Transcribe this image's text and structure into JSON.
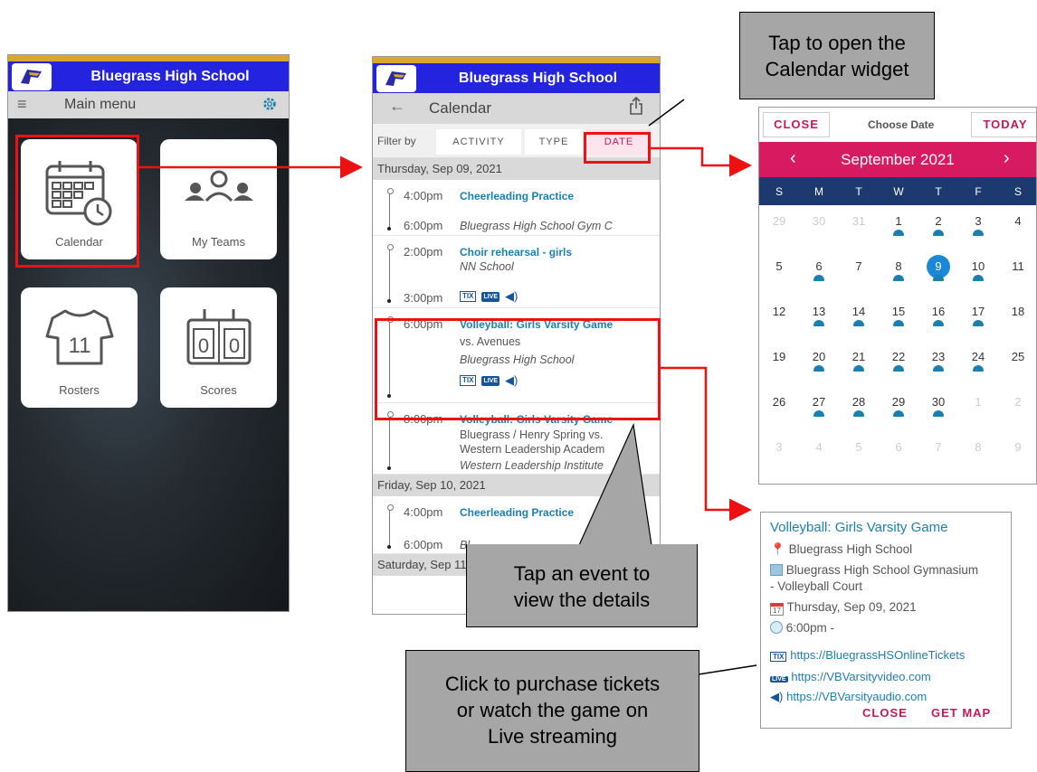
{
  "school_name": "Bluegrass High School",
  "colors": {
    "header_blue": "#2323e0",
    "accent_gold": "#d9a62e",
    "accent_pink": "#d81b60",
    "link_blue": "#1b7fb0",
    "calendar_navy": "#1c3a70",
    "highlight_red": "#ee1111",
    "callout_gray": "#a6a6a6"
  },
  "phone1": {
    "menu_label": "Main menu",
    "tiles": [
      {
        "label": "Calendar",
        "icon": "calendar-icon"
      },
      {
        "label": "My Teams",
        "icon": "team-icon"
      },
      {
        "label": "Rosters",
        "icon": "jersey-icon",
        "jersey_number": "11"
      },
      {
        "label": "Scores",
        "icon": "scoreboard-icon",
        "score_left": "0",
        "score_right": "0"
      }
    ]
  },
  "phone2": {
    "menu_label": "Calendar",
    "filter_label": "Filter by",
    "filters": [
      "ACTIVITY",
      "TYPE",
      "DATE"
    ],
    "days": [
      {
        "header": "Thursday, Sep 09, 2021"
      },
      {
        "header": "Friday, Sep 10, 2021"
      },
      {
        "header": "Saturday, Sep 11"
      }
    ],
    "events": [
      {
        "start": "4:00pm",
        "end": "6:00pm",
        "name": "Cheerleading Practice",
        "location": "Bluegrass High School Gym C"
      },
      {
        "start": "2:00pm",
        "end": "3:00pm",
        "name": "Choir rehearsal - girls",
        "location": "NN School"
      },
      {
        "start": "6:00pm",
        "name": "Volleyball: Girls Varsity Game",
        "opponent": "vs. Avenues",
        "location": "Bluegrass High School"
      },
      {
        "start": "8:00pm",
        "name": "Volleyball: Girls Varsity Game",
        "opponent_line1": "Bluegrass / Henry Spring vs.",
        "opponent_line2": "Western Leadership Academ",
        "location": "Western Leadership Institute"
      },
      {
        "start": "4:00pm",
        "end": "6:00pm",
        "name": "Cheerleading Practice",
        "location": "Bl"
      }
    ],
    "badges": {
      "tix": "TIX",
      "live": "LIVE"
    }
  },
  "calendar": {
    "close": "CLOSE",
    "title": "Choose Date",
    "today": "TODAY",
    "month_label": "September 2021",
    "prev": "‹",
    "next": "›",
    "dow": [
      "S",
      "M",
      "T",
      "W",
      "T",
      "F",
      "S"
    ],
    "weeks": [
      [
        [
          "29",
          0,
          0
        ],
        [
          "30",
          0,
          0
        ],
        [
          "31",
          0,
          0
        ],
        [
          "1",
          1,
          0
        ],
        [
          "2",
          1,
          0
        ],
        [
          "3",
          1,
          0
        ],
        [
          "4",
          0,
          0
        ]
      ],
      [
        [
          "5",
          0,
          0
        ],
        [
          "6",
          1,
          0
        ],
        [
          "7",
          0,
          0
        ],
        [
          "8",
          1,
          0
        ],
        [
          "9",
          1,
          1
        ],
        [
          "10",
          1,
          0
        ],
        [
          "11",
          0,
          0
        ]
      ],
      [
        [
          "12",
          0,
          0
        ],
        [
          "13",
          1,
          0
        ],
        [
          "14",
          1,
          0
        ],
        [
          "15",
          1,
          0
        ],
        [
          "16",
          1,
          0
        ],
        [
          "17",
          1,
          0
        ],
        [
          "18",
          0,
          0
        ]
      ],
      [
        [
          "19",
          0,
          0
        ],
        [
          "20",
          1,
          0
        ],
        [
          "21",
          1,
          0
        ],
        [
          "22",
          1,
          0
        ],
        [
          "23",
          1,
          0
        ],
        [
          "24",
          1,
          0
        ],
        [
          "25",
          0,
          0
        ]
      ],
      [
        [
          "26",
          0,
          0
        ],
        [
          "27",
          1,
          0
        ],
        [
          "28",
          1,
          0
        ],
        [
          "29",
          1,
          0
        ],
        [
          "30",
          1,
          0
        ],
        [
          "1",
          0,
          0
        ],
        [
          "2",
          0,
          0
        ]
      ],
      [
        [
          "3",
          0,
          0
        ],
        [
          "4",
          0,
          0
        ],
        [
          "5",
          0,
          0
        ],
        [
          "6",
          0,
          0
        ],
        [
          "7",
          0,
          0
        ],
        [
          "8",
          0,
          0
        ],
        [
          "9",
          0,
          0
        ]
      ]
    ],
    "dim_rows_out_of_month": {
      "first_row_dim_count": 3,
      "fifth_row_dim_from": 5
    },
    "selected_day": "9"
  },
  "detail": {
    "title": "Volleyball: Girls Varsity Game",
    "location": "Bluegrass High School",
    "facility_line1": "Bluegrass High School Gymnasium",
    "facility_line2": "- Volleyball Court",
    "date": "Thursday, Sep 09, 2021",
    "time": "6:00pm -",
    "tickets_url": "https://BluegrassHSOnlineTickets",
    "video_url": "https://VBVarsityvideo.com",
    "audio_url": "https://VBVarsityaudio.com",
    "close": "CLOSE",
    "get_map": "GET MAP"
  },
  "callouts": {
    "open_calendar": [
      "Tap to open the",
      "Calendar widget"
    ],
    "tap_event": [
      "Tap an event to",
      "view the details"
    ],
    "purchase": [
      "Click to purchase tickets",
      "or watch the game on",
      "Live streaming"
    ]
  }
}
